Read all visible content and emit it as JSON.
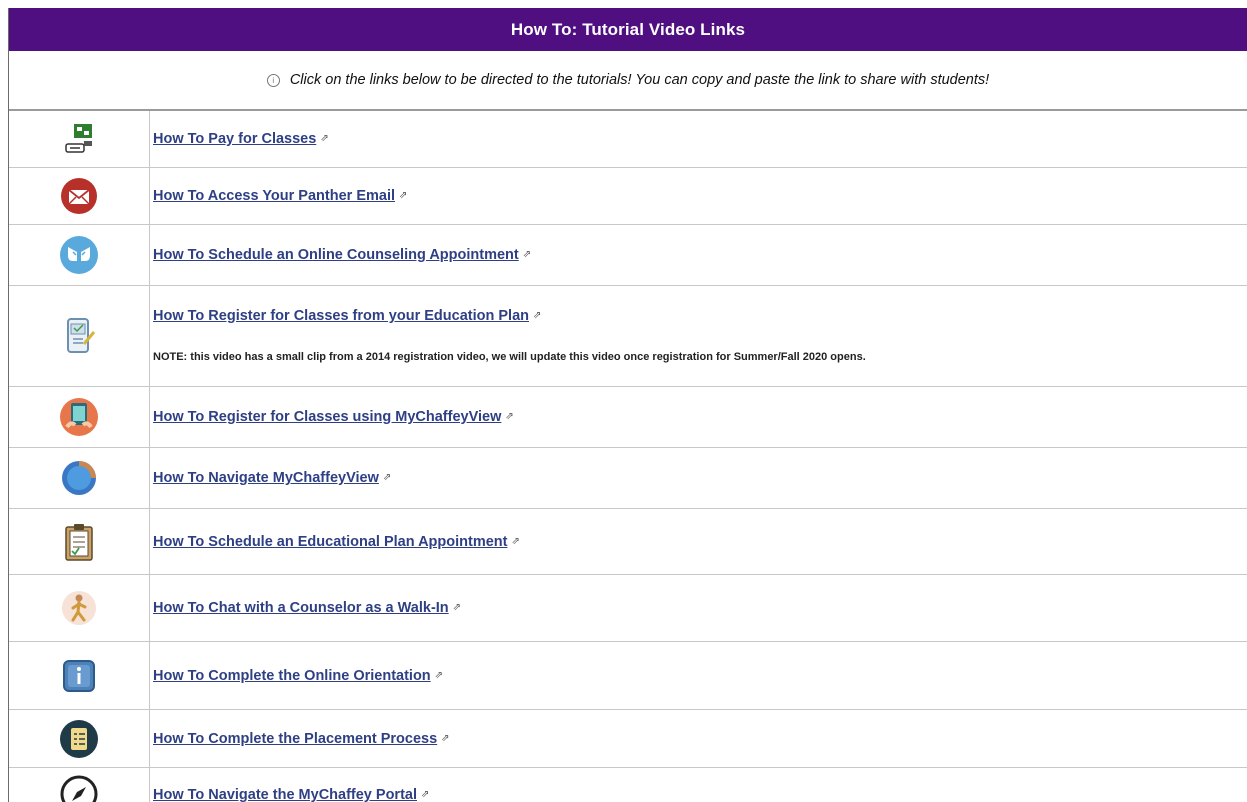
{
  "header": {
    "title": "How To: Tutorial Video Links"
  },
  "info": {
    "text": "Click on the links below to be directed to the tutorials! You can copy and paste the link to share with students!"
  },
  "rows": [
    {
      "icon": "pay-classes-icon",
      "label": "How To Pay for Classes"
    },
    {
      "icon": "email-icon",
      "label": "How To Access Your Panther Email"
    },
    {
      "icon": "counseling-icon",
      "label": "How To Schedule an Online Counseling Appointment"
    },
    {
      "icon": "education-plan-icon",
      "label": "How To Register for Classes from your Education Plan",
      "note": "NOTE: this video has a small clip from a 2014 registration video, we will update this video once registration for Summer/Fall 2020 opens."
    },
    {
      "icon": "tablet-icon",
      "label": "How To Register for Classes using MyChaffeyView"
    },
    {
      "icon": "compass-icon",
      "label": "How To Navigate MyChaffeyView"
    },
    {
      "icon": "clipboard-icon",
      "label": "How To Schedule an Educational Plan Appointment"
    },
    {
      "icon": "walking-person-icon",
      "label": "How To Chat with a Counselor as a Walk-In"
    },
    {
      "icon": "info-icon",
      "label": "How To Complete the Online Orientation"
    },
    {
      "icon": "checklist-icon",
      "label": "How To Complete the Placement Process"
    },
    {
      "icon": "portal-compass-icon",
      "label": "How To Navigate the MyChaffey Portal"
    }
  ],
  "colors": {
    "header_bg": "#4f0f80",
    "link": "#2e3f84"
  }
}
